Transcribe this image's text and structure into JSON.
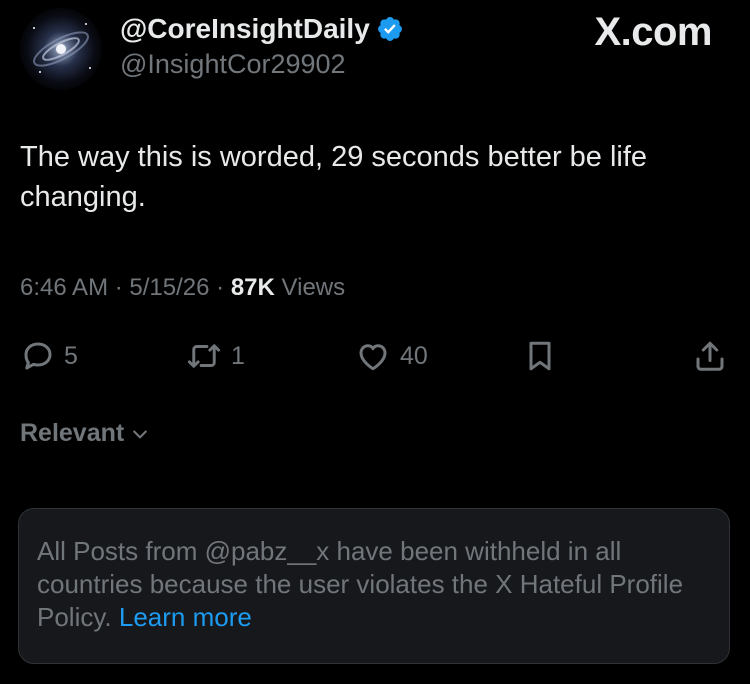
{
  "author": {
    "display_name": "@CoreInsightDaily",
    "handle": "@InsightCor29902",
    "verified_color": "#1d9bf0"
  },
  "brand": "X.com",
  "post": {
    "text": "The way this is worded, 29 seconds better be life changing.",
    "time": "6:46 AM",
    "date": "5/15/26",
    "views_count": "87K",
    "views_label": "Views"
  },
  "actions": {
    "replies": "5",
    "reposts": "1",
    "likes": "40"
  },
  "sort": {
    "label": "Relevant"
  },
  "notice": {
    "text": "All Posts from @pabz__x have been withheld in all countries because the user violates the X Hateful Profile Policy.",
    "link": "Learn more"
  },
  "colors": {
    "background": "#000000",
    "text_primary": "#e7e9ea",
    "text_secondary": "#71767b",
    "accent": "#1d9bf0"
  }
}
